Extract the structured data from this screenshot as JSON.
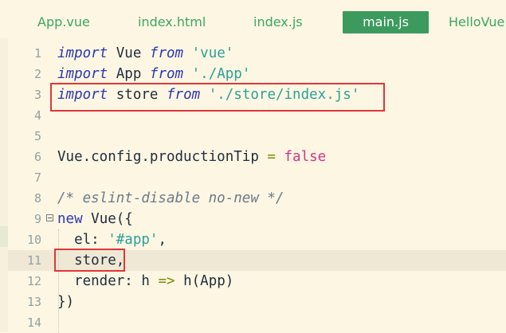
{
  "tabs": [
    {
      "label": "App.vue"
    },
    {
      "label": "index.html"
    },
    {
      "label": "index.js"
    },
    {
      "label": "main.js"
    },
    {
      "label": "HelloVue"
    }
  ],
  "active_tab": "main.js",
  "colors": {
    "background": "#fdf6e3",
    "active_tab": "#3d9a5f",
    "tab_text": "#3ca860",
    "highlight_box": "#e0363b",
    "current_line": "#eee8d5"
  },
  "editor": {
    "lines": [
      {
        "n": "1",
        "tokens": [
          [
            "kw",
            "import"
          ],
          [
            "",
            "Vue"
          ],
          [
            "kw",
            "from"
          ],
          [
            "str",
            "'vue'"
          ]
        ]
      },
      {
        "n": "2",
        "tokens": [
          [
            "kw",
            "import"
          ],
          [
            "",
            "App"
          ],
          [
            "kw",
            "from"
          ],
          [
            "str",
            "'./App'"
          ]
        ]
      },
      {
        "n": "3",
        "tokens": [
          [
            "kw",
            "import"
          ],
          [
            "",
            "store"
          ],
          [
            "kw",
            "from"
          ],
          [
            "str",
            "'./store/index.js'"
          ]
        ]
      },
      {
        "n": "4",
        "tokens": []
      },
      {
        "n": "5",
        "tokens": []
      },
      {
        "n": "6",
        "tokens": [
          [
            "",
            "Vue.config.productionTip"
          ],
          [
            "op",
            "="
          ],
          [
            "bool",
            "false"
          ]
        ]
      },
      {
        "n": "7",
        "tokens": []
      },
      {
        "n": "8",
        "tokens": [
          [
            "cm",
            "/* eslint-disable no-new */"
          ]
        ]
      },
      {
        "n": "9",
        "tokens": [
          [
            "kw2",
            "new"
          ],
          [
            "",
            "Vue({"
          ]
        ],
        "fold": true
      },
      {
        "n": "10",
        "tokens": [
          [
            "",
            "  el:"
          ],
          [
            "str",
            "'#app'"
          ],
          [
            "",
            ","
          ]
        ]
      },
      {
        "n": "11",
        "tokens": [
          [
            "",
            "  store,"
          ]
        ],
        "current": true
      },
      {
        "n": "12",
        "tokens": [
          [
            "",
            "  render:"
          ],
          [
            "",
            "h"
          ],
          [
            "op",
            "=>"
          ],
          [
            "",
            "h(App)"
          ]
        ]
      },
      {
        "n": "13",
        "tokens": [
          [
            "",
            "})"
          ]
        ]
      },
      {
        "n": "14",
        "tokens": []
      }
    ]
  }
}
